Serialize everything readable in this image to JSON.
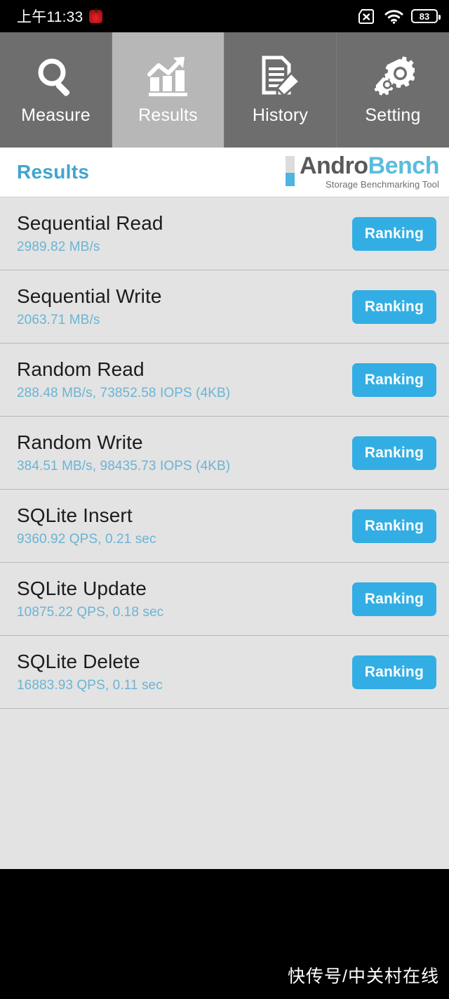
{
  "statusbar": {
    "time": "上午11:33",
    "app_icon": "alarm-app-icon",
    "sim_icon": "sim-card-disabled-icon",
    "wifi_icon": "wifi-icon",
    "battery_icon": "battery-icon",
    "battery_level": "83"
  },
  "tabs": [
    {
      "label": "Measure",
      "icon": "magnifier-icon",
      "active": false
    },
    {
      "label": "Results",
      "icon": "bar-chart-arrow-icon",
      "active": true
    },
    {
      "label": "History",
      "icon": "document-pencil-icon",
      "active": false
    },
    {
      "label": "Setting",
      "icon": "gears-icon",
      "active": false
    }
  ],
  "header": {
    "title": "Results",
    "logo_primary": "Andro",
    "logo_secondary": "Bench",
    "logo_subtitle": "Storage Benchmarking Tool"
  },
  "results": [
    {
      "name": "Sequential Read",
      "value": "2989.82 MB/s",
      "button": "Ranking"
    },
    {
      "name": "Sequential Write",
      "value": "2063.71 MB/s",
      "button": "Ranking"
    },
    {
      "name": "Random Read",
      "value": "288.48 MB/s, 73852.58 IOPS (4KB)",
      "button": "Ranking"
    },
    {
      "name": "Random Write",
      "value": "384.51 MB/s, 98435.73 IOPS (4KB)",
      "button": "Ranking"
    },
    {
      "name": "SQLite Insert",
      "value": "9360.92 QPS, 0.21 sec",
      "button": "Ranking"
    },
    {
      "name": "SQLite Update",
      "value": "10875.22 QPS, 0.18 sec",
      "button": "Ranking"
    },
    {
      "name": "SQLite Delete",
      "value": "16883.93 QPS, 0.11 sec",
      "button": "Ranking"
    }
  ],
  "footer": {
    "watermark": "快传号/中关村在线"
  },
  "colors": {
    "accent_blue": "#32aee4",
    "title_blue": "#40a5cd",
    "value_blue": "#6bb4d4",
    "tab_inactive": "#6e6e6e",
    "tab_active": "#b7b7b7",
    "list_bg": "#e3e3e3"
  }
}
